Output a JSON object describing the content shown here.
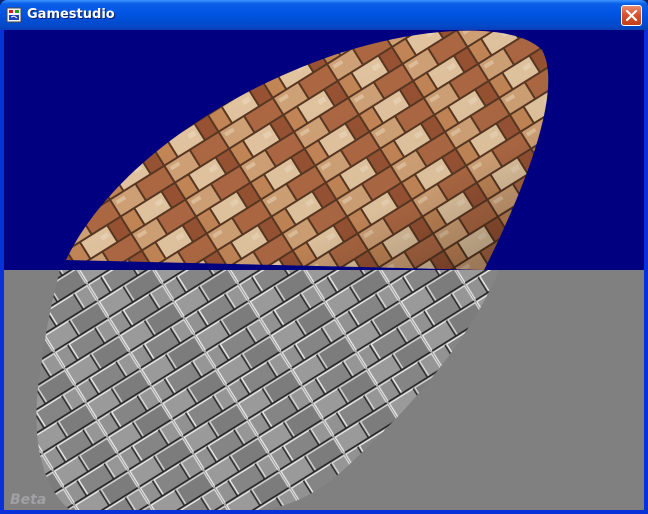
{
  "window": {
    "title": "Gamestudio",
    "app_icon": "gamestudio-icon",
    "close_icon": "close-icon"
  },
  "viewport": {
    "upper_color": "#000080",
    "lower_color": "#808080",
    "object_texture": "stone-brick-texture",
    "watermark": "Beta"
  },
  "colors": {
    "titlebar": "#0054e3",
    "close_button": "#d8522e",
    "frame": "#0831d9"
  }
}
